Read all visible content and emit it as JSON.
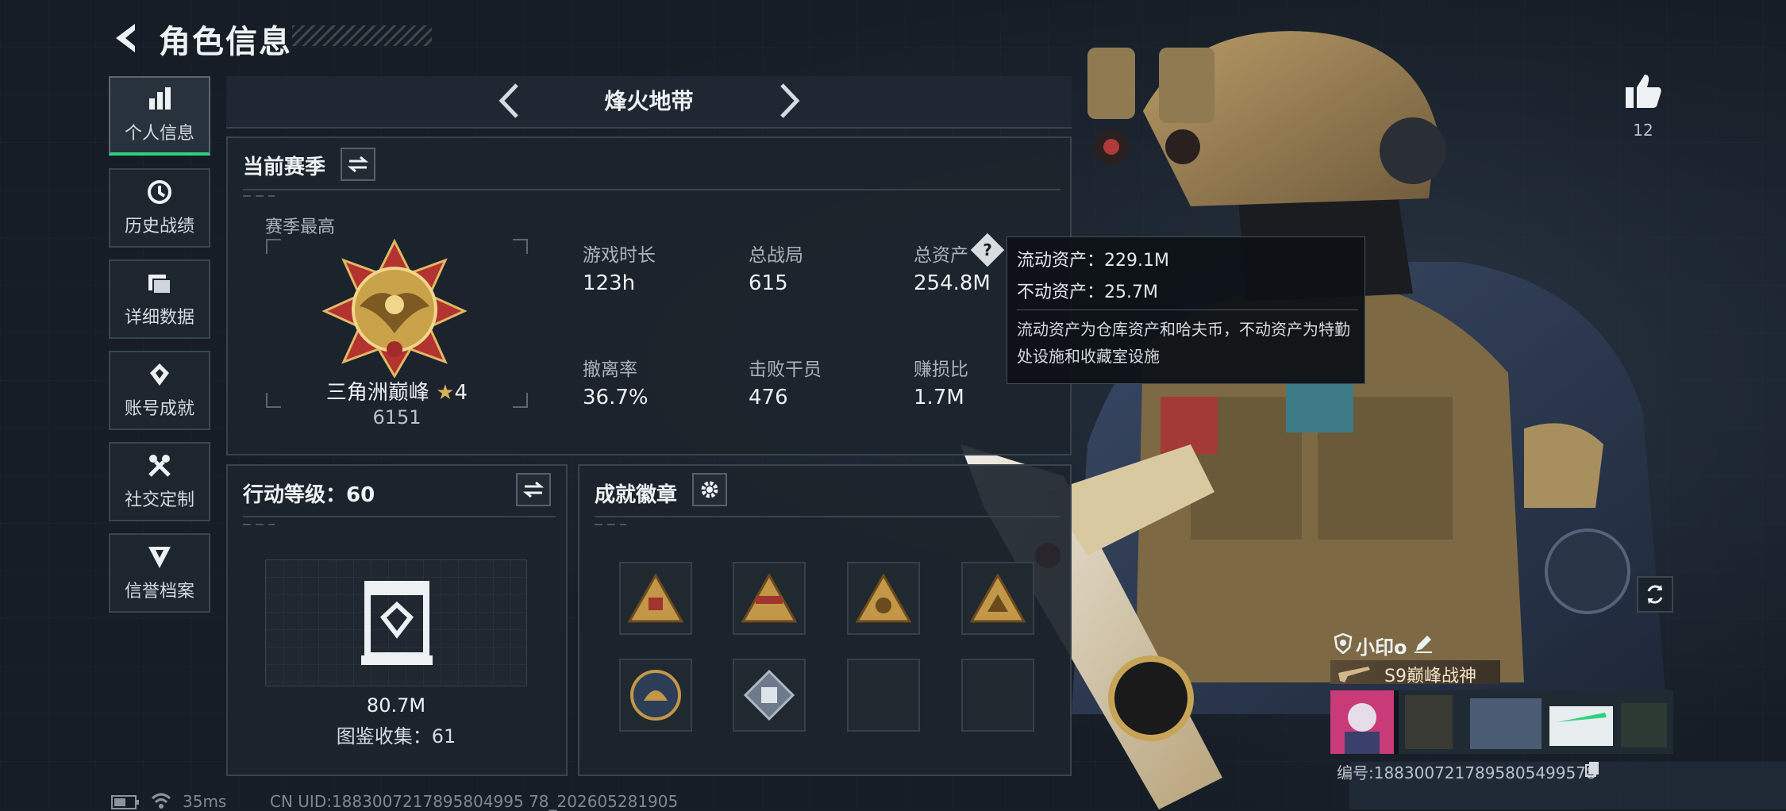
{
  "header": {
    "title": "角色信息"
  },
  "sidebar": {
    "items": [
      {
        "label": "个人信息",
        "icon": "bar-chart-icon",
        "active": true
      },
      {
        "label": "历史战绩",
        "icon": "history-icon"
      },
      {
        "label": "详细数据",
        "icon": "folder-icon"
      },
      {
        "label": "账号成就",
        "icon": "achievement-icon"
      },
      {
        "label": "社交定制",
        "icon": "tools-icon"
      },
      {
        "label": "信誉档案",
        "icon": "reputation-icon"
      }
    ]
  },
  "mode": {
    "title": "烽火地带"
  },
  "season": {
    "title": "当前赛季",
    "best_label": "赛季最高",
    "rank_name": "三角洲巅峰",
    "rank_stars": "4",
    "rank_score": "6151",
    "stats": [
      {
        "label": "游戏时长",
        "value": "123h"
      },
      {
        "label": "总战局",
        "value": "615"
      },
      {
        "label": "总资产",
        "value": "254.8M"
      },
      {
        "label": "撤离率",
        "value": "36.7%"
      },
      {
        "label": "击败干员",
        "value": "476"
      },
      {
        "label": "赚损比",
        "value": "1.7M"
      }
    ]
  },
  "tooltip": {
    "liquid": "流动资产：229.1M",
    "fixed": "不动资产：25.7M",
    "note": "流动资产为仓库资产和哈夫币，不动资产为特勤处设施和收藏室设施"
  },
  "action": {
    "title": "行动等级：60",
    "value": "80.7M",
    "collection": "图鉴收集：61"
  },
  "badges": {
    "title": "成就徽章"
  },
  "likes": {
    "count": "12"
  },
  "profile": {
    "name": "小印o",
    "title_badge": "S9巅峰战神",
    "id_text": "编号:1883007217895805499578"
  },
  "status": {
    "ping": "35ms",
    "uid": "CN UID:1883007217895804995 78_202605281905"
  },
  "colors": {
    "accent": "#2fd37d",
    "gold": "#c9a24a",
    "bg": "#161d26"
  }
}
